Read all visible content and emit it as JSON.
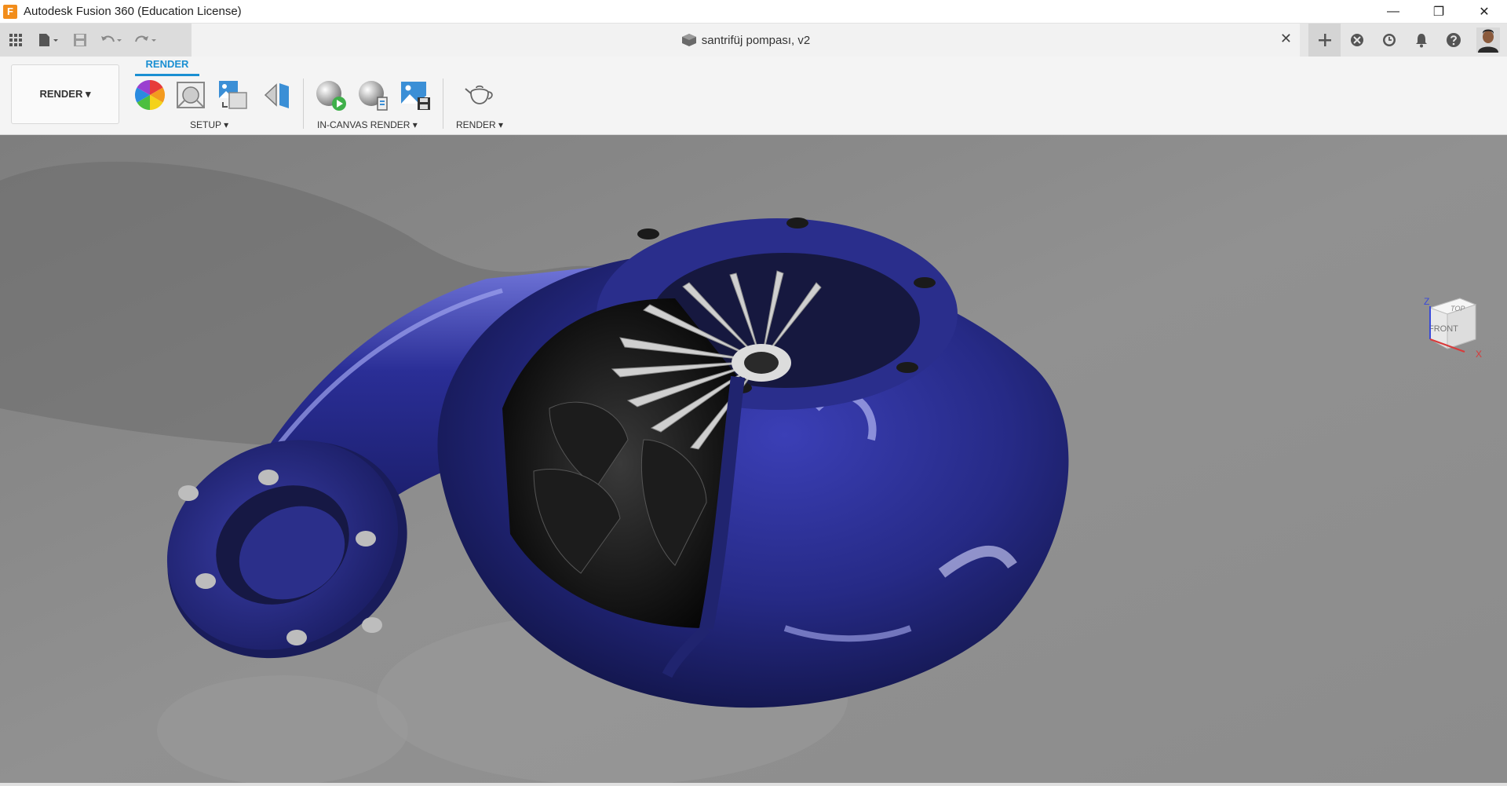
{
  "titlebar": {
    "app_title": "Autodesk Fusion 360 (Education License)",
    "logo_letter": "F",
    "minimize": "—",
    "restore": "❐",
    "close": "✕"
  },
  "tabbar": {
    "document_title": "santrifüj pompası, v2",
    "close": "✕"
  },
  "toolbar": {
    "workspace_button": "RENDER ▾",
    "active_tab": "RENDER",
    "groups": {
      "setup": "SETUP ▾",
      "in_canvas_render": "IN-CANVAS RENDER ▾",
      "render": "RENDER ▾"
    }
  },
  "viewcube": {
    "top": "TOP",
    "front": "FRONT",
    "axis_z": "Z",
    "axis_x": "X"
  },
  "colors": {
    "accent": "#1a8fd2",
    "pump_body": "#2b2d8a",
    "viewport_bg": "#8a8a8a"
  }
}
